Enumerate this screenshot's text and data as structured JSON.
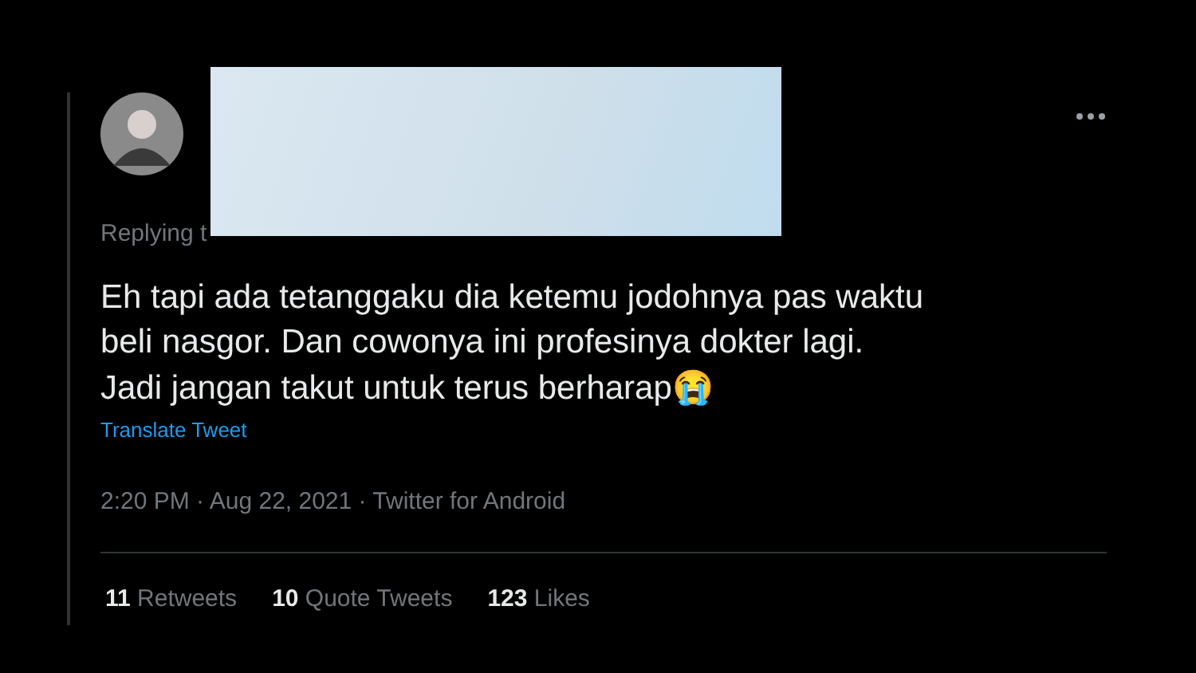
{
  "tweet": {
    "replying_to": "Replying t",
    "text_lines": [
      "Eh tapi ada tetanggaku dia ketemu jodohnya pas waktu",
      "beli nasgor. Dan cowonya ini profesinya dokter lagi.",
      "Jadi jangan takut untuk terus berharap😭"
    ],
    "translate": "Translate Tweet",
    "meta": "2:20 PM · Aug 22, 2021 · Twitter for Android",
    "stats": [
      {
        "count": "11",
        "label": "Retweets"
      },
      {
        "count": "10",
        "label": "Quote Tweets"
      },
      {
        "count": "123",
        "label": "Likes"
      }
    ]
  }
}
